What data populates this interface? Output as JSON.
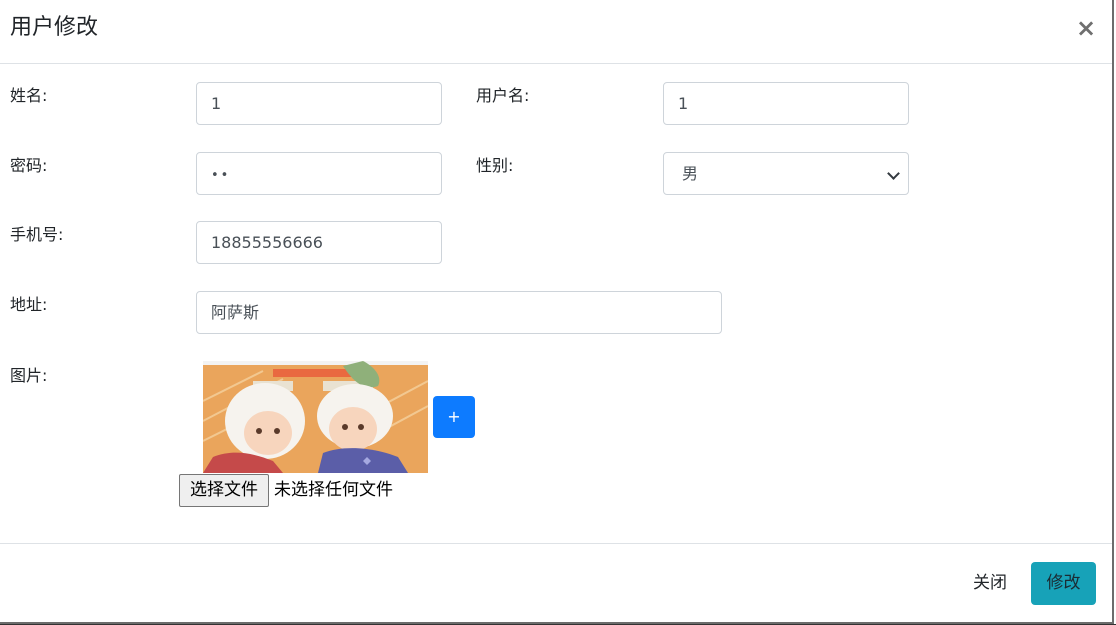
{
  "modal": {
    "title": "用户修改",
    "close_symbol": "×"
  },
  "form": {
    "name_label": "姓名:",
    "name_value": "1",
    "username_label": "用户名:",
    "username_value": "1",
    "password_label": "密码:",
    "password_value": "••",
    "gender_label": "性别:",
    "gender_value": "男",
    "phone_label": "手机号:",
    "phone_value": "18855556666",
    "address_label": "地址:",
    "address_value": "阿萨斯",
    "image_label": "图片:",
    "add_image_label": "+",
    "file_button_label": "选择文件",
    "file_status": "未选择任何文件"
  },
  "footer": {
    "close_label": "关闭",
    "submit_label": "修改"
  },
  "colors": {
    "primary": "#0d7bff",
    "info": "#17a2b8",
    "border": "#ced4da"
  }
}
